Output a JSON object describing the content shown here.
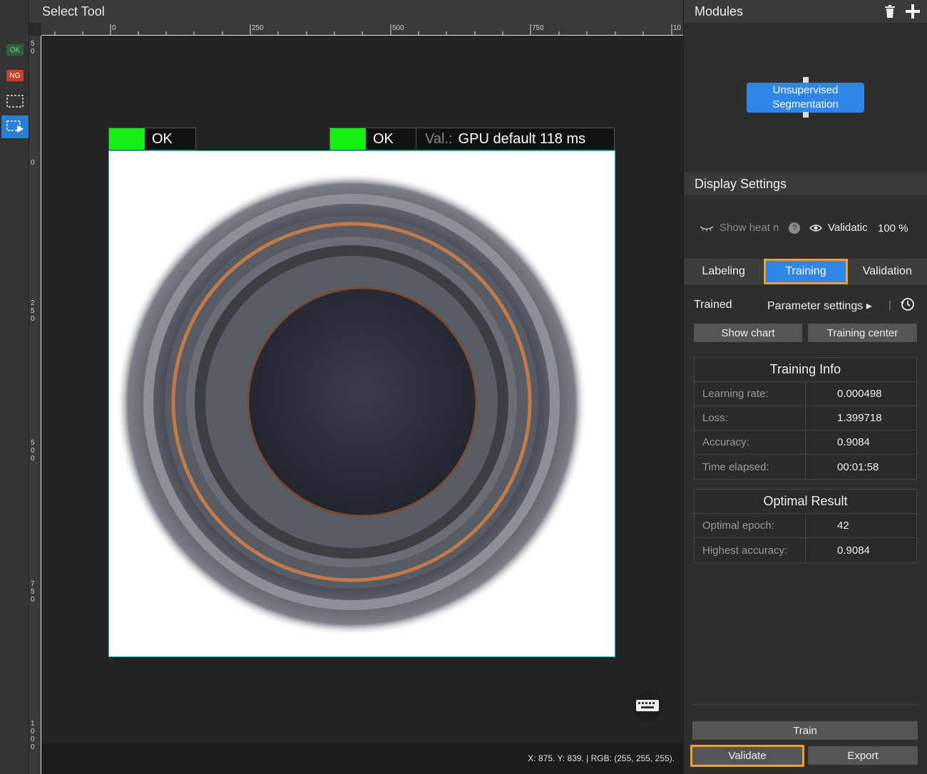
{
  "left_toolbar": {
    "ok_tag": "OK",
    "ng_tag": "NG"
  },
  "canvas": {
    "title": "Select Tool",
    "ruler_h_labels": [
      "0",
      "250",
      "500",
      "750",
      "10"
    ],
    "ruler_v_labels": [
      "50",
      "0",
      "250",
      "500",
      "750",
      "1000"
    ],
    "results": [
      {
        "status": "OK"
      },
      {
        "status": "OK",
        "val_label": "Val.:",
        "val_value": "GPU default 118 ms"
      }
    ],
    "coords": "X: 875. Y: 839. | RGB: (255, 255, 255)."
  },
  "modules": {
    "title": "Modules",
    "node_line1": "Unsupervised",
    "node_line2": "Segmentation"
  },
  "display_settings": {
    "title": "Display Settings",
    "heatmap_label": "Show heat n",
    "validation_label": "Validatic",
    "opacity": "100 %"
  },
  "tabs": [
    "Labeling",
    "Training",
    "Validation"
  ],
  "active_tab": "Training",
  "training": {
    "status": "Trained",
    "param_settings": "Parameter settings ▸",
    "show_chart": "Show chart",
    "training_center": "Training center"
  },
  "training_info": {
    "title": "Training Info",
    "rows": [
      {
        "key": "Learning rate:",
        "value": "0.000498"
      },
      {
        "key": "Loss:",
        "value": "1.399718"
      },
      {
        "key": "Accuracy:",
        "value": "0.9084"
      },
      {
        "key": "Time elapsed:",
        "value": "00:01:58"
      }
    ]
  },
  "optimal_result": {
    "title": "Optimal Result",
    "rows": [
      {
        "key": "Optimal epoch:",
        "value": "42"
      },
      {
        "key": "Highest accuracy:",
        "value": "0.9084"
      }
    ]
  },
  "actions": {
    "train": "Train",
    "validate": "Validate",
    "export": "Export"
  }
}
